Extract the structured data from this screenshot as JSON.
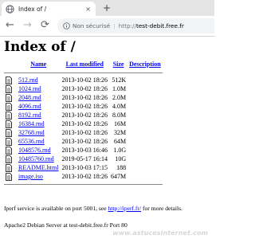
{
  "browser": {
    "tab_title": "Index of /",
    "tab_close": "×",
    "new_tab": "+",
    "back": "←",
    "forward": "→",
    "reload": "⟳",
    "security_label": "Non sécurisé",
    "separator": "|",
    "url_scheme": "http://",
    "url_host": "test-debit.free.fr",
    "icons": [
      "favicon-icon",
      "info-icon",
      "file-icon"
    ]
  },
  "page": {
    "heading": "Index of /",
    "columns": {
      "name": "Name",
      "last_modified": "Last modified",
      "size": "Size",
      "description": "Description"
    },
    "files": [
      {
        "name": "512.rnd",
        "modified": "2013-10-02 18:26",
        "size": "512K"
      },
      {
        "name": "1024.rnd",
        "modified": "2013-10-02 18:26",
        "size": "1.0M"
      },
      {
        "name": "2048.rnd",
        "modified": "2013-10-02 18:26",
        "size": "2.0M"
      },
      {
        "name": "4096.rnd",
        "modified": "2013-10-02 18:26",
        "size": "4.0M"
      },
      {
        "name": "8192.rnd",
        "modified": "2013-10-02 18:26",
        "size": "8.0M"
      },
      {
        "name": "16384.rnd",
        "modified": "2013-10-02 18:26",
        "size": "16M"
      },
      {
        "name": "32768.rnd",
        "modified": "2013-10-02 18:26",
        "size": "32M"
      },
      {
        "name": "65536.rnd",
        "modified": "2013-10-02 18:26",
        "size": "64M"
      },
      {
        "name": "1048576.rnd",
        "modified": "2013-10-03 16:46",
        "size": "1.0G"
      },
      {
        "name": "10485760.rnd",
        "modified": "2019-05-17 16:14",
        "size": "10G"
      },
      {
        "name": "README.html",
        "modified": "2013-10-03 17:15",
        "size": "188"
      },
      {
        "name": "image.iso",
        "modified": "2013-10-02 18:26",
        "size": "647M"
      }
    ],
    "footer_text_before": "Iperf service is available on port 5001, see ",
    "footer_link": "http://iperf.fr/",
    "footer_text_after": " for more details.",
    "server_signature": "Apache2 Debian Server at test-debit.free.fr Port 80"
  },
  "watermark": "www.astucesinternet.com"
}
